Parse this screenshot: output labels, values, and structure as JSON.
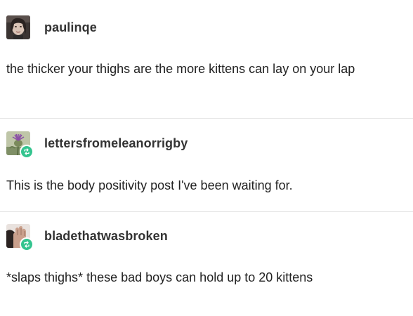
{
  "posts": [
    {
      "username": "paulinqe",
      "text": "the thicker your thighs are the more kittens can lay on your lap",
      "avatar_icon": "portrait-avatar-icon",
      "reblogged": false
    },
    {
      "username": "lettersfromeleanorrigby",
      "text": "This is the body positivity post I've been waiting for.",
      "avatar_icon": "thistle-flower-avatar-icon",
      "reblogged": true
    },
    {
      "username": "bladethatwasbroken",
      "text": "*slaps thighs* these bad boys can hold up to 20 kittens",
      "avatar_icon": "hand-avatar-icon",
      "reblogged": true
    }
  ],
  "colors": {
    "text": "#222222",
    "username": "#333333",
    "divider": "#e4e4e4",
    "reblog_badge": "#34c48f",
    "background": "#ffffff"
  }
}
